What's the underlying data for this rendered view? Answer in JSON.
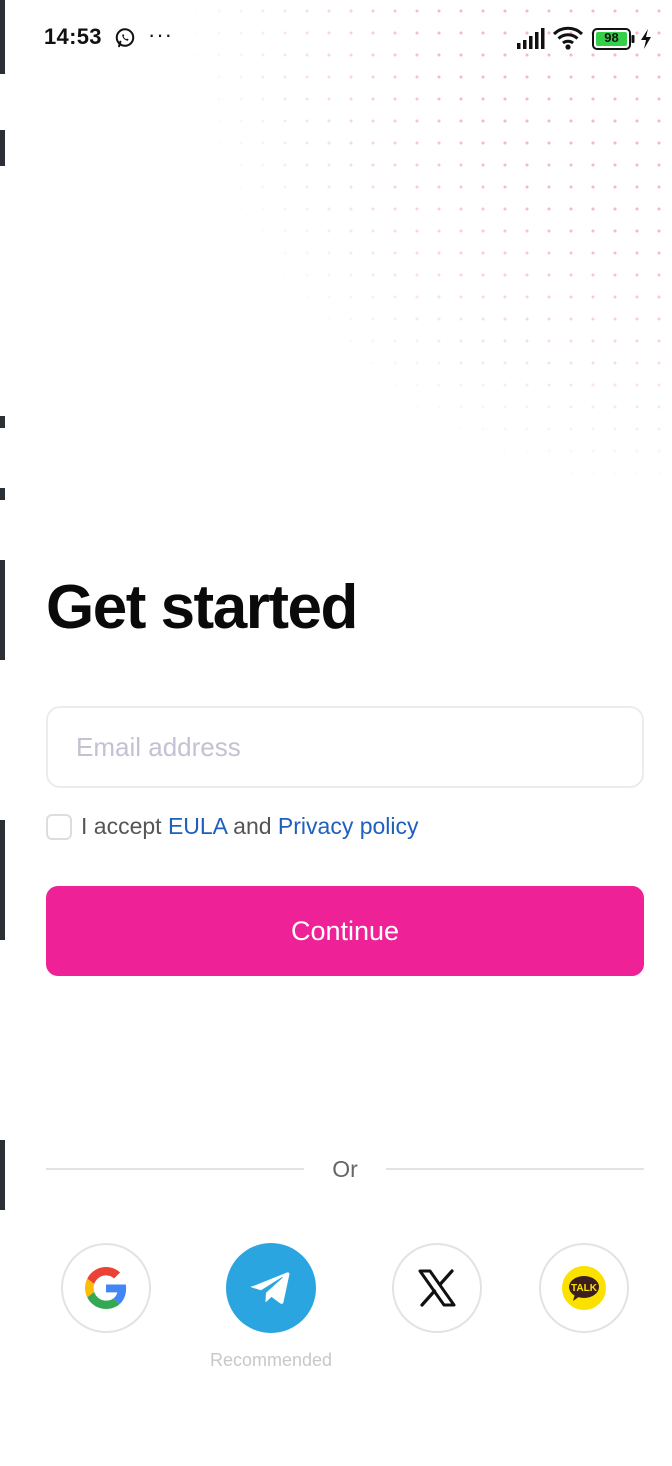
{
  "status_bar": {
    "time": "14:53",
    "battery_level": "98",
    "icons": [
      "whatsapp-icon",
      "more-icon",
      "signal-icon",
      "wifi-icon",
      "battery-icon",
      "charging-icon"
    ],
    "more_glyph": "···"
  },
  "heading": "Get started",
  "email_input": {
    "placeholder": "Email address",
    "value": ""
  },
  "consent": {
    "checked": false,
    "prefix": "I accept",
    "eula_link": "EULA",
    "conjunction": "and",
    "privacy_link": "Privacy policy"
  },
  "continue_button": "Continue",
  "divider_text": "Or",
  "social_logins": [
    {
      "name": "Google",
      "icon": "google-icon"
    },
    {
      "name": "Telegram",
      "icon": "telegram-icon",
      "caption": "Recommended"
    },
    {
      "name": "X",
      "icon": "x-icon"
    },
    {
      "name": "KakaoTalk",
      "icon": "kakaotalk-icon",
      "badge_text": "TALK"
    }
  ],
  "colors": {
    "accent": "#ee2296",
    "link": "#1e5fbf",
    "telegram": "#2aa5e0",
    "kakao": "#fae100",
    "dots": "#f06e8c"
  }
}
